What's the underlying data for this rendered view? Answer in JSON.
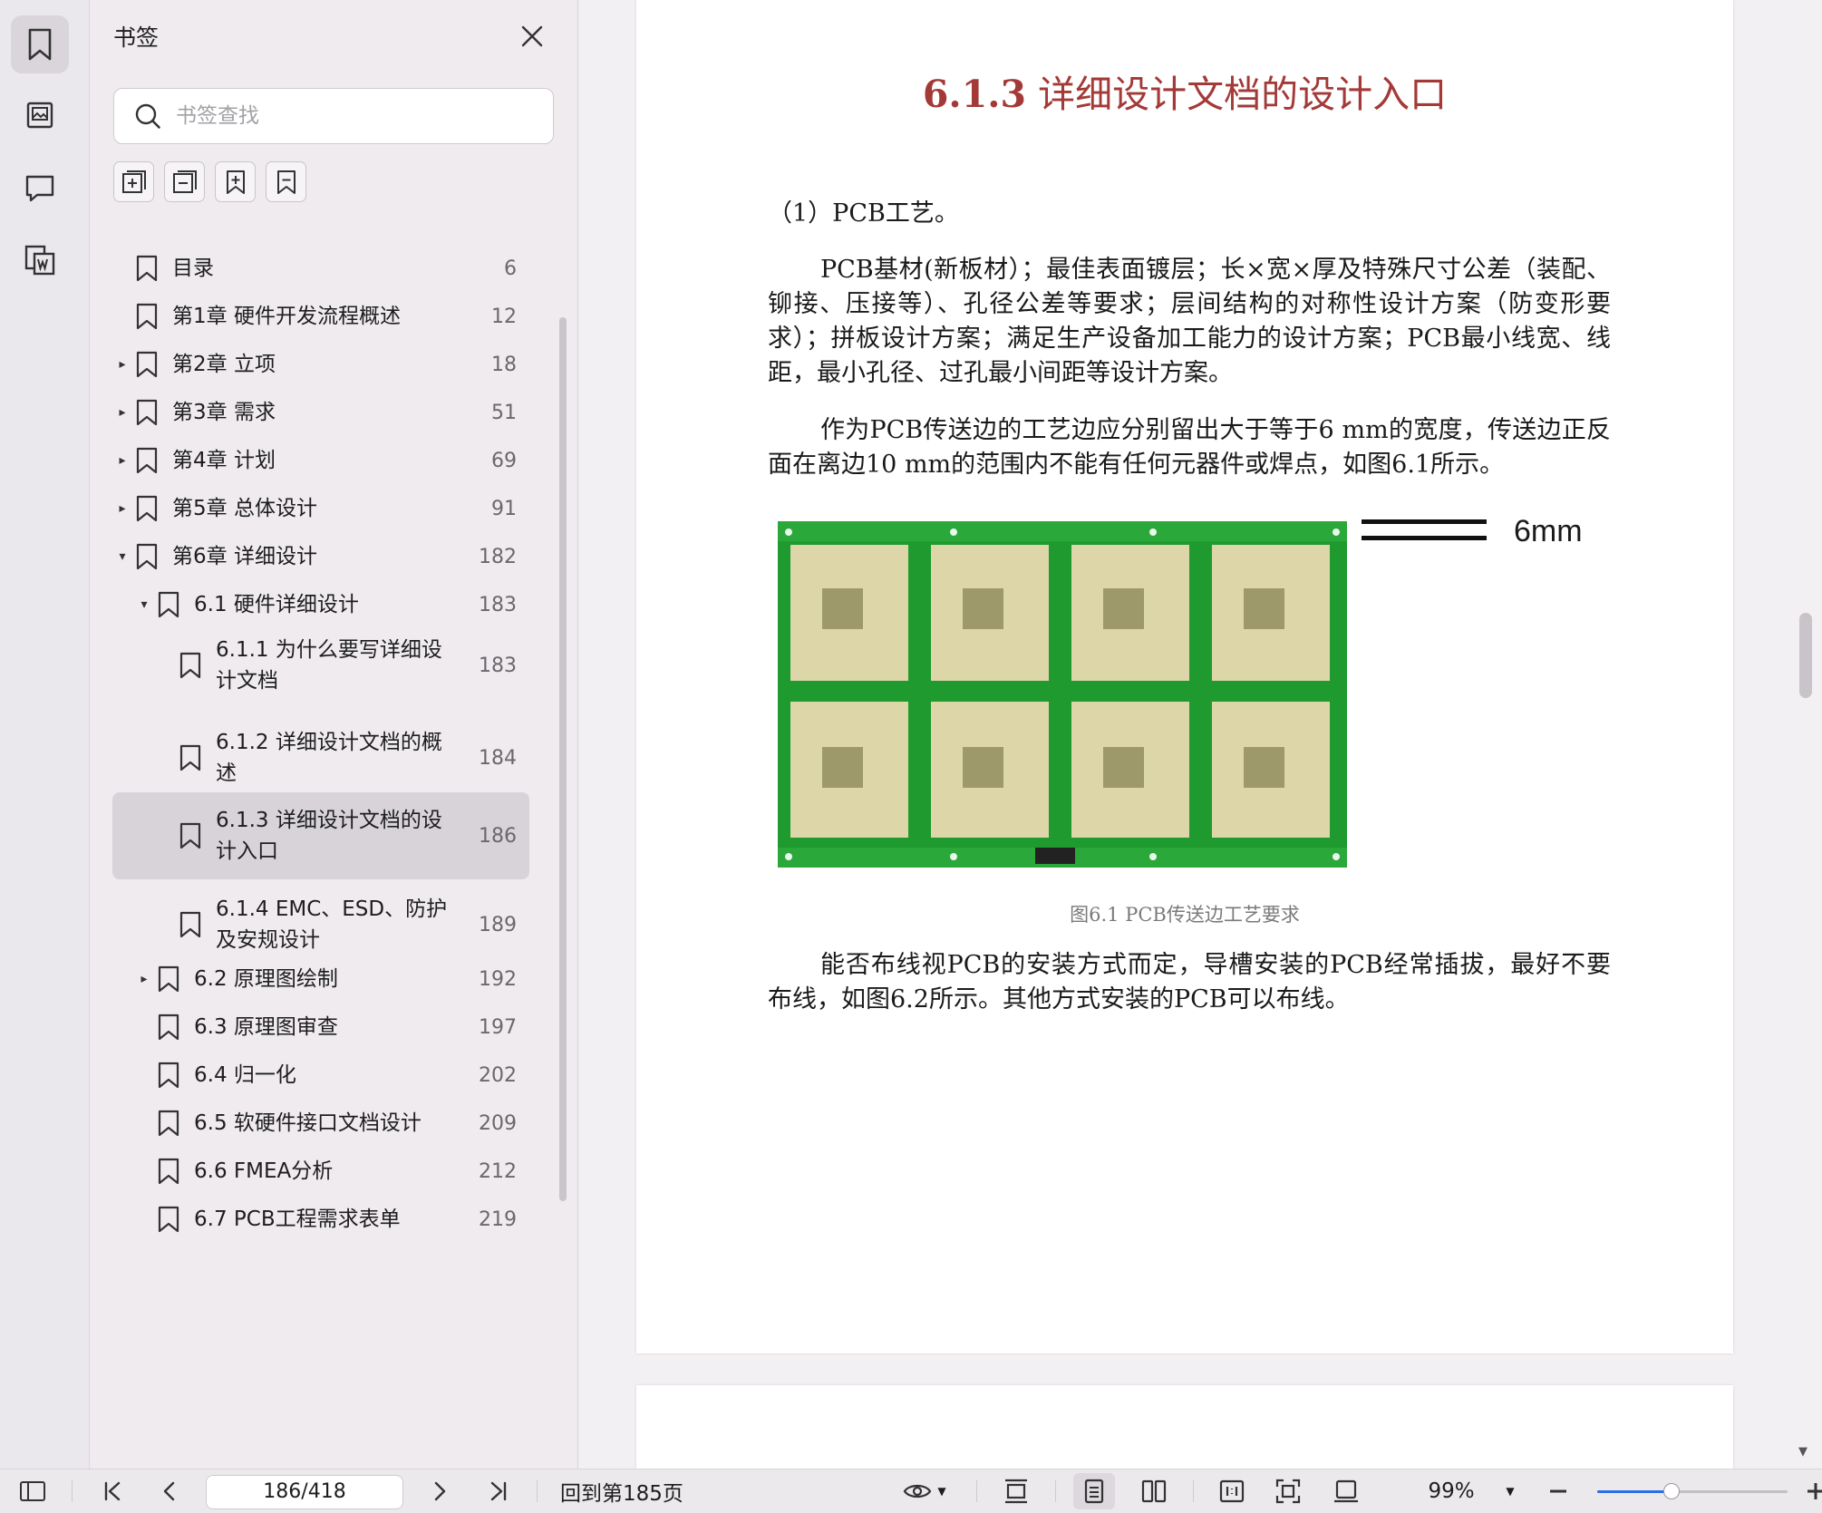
{
  "panel": {
    "title": "书签",
    "search_placeholder": "书签查找"
  },
  "bookmarks": [
    {
      "label": "目录",
      "page": "6",
      "level": 0,
      "arrow": ""
    },
    {
      "label": "第1章 硬件开发流程概述",
      "page": "12",
      "level": 0,
      "arrow": ""
    },
    {
      "label": "第2章 立项",
      "page": "18",
      "level": 0,
      "arrow": "▸"
    },
    {
      "label": "第3章 需求",
      "page": "51",
      "level": 0,
      "arrow": "▸"
    },
    {
      "label": "第4章 计划",
      "page": "69",
      "level": 0,
      "arrow": "▸"
    },
    {
      "label": "第5章 总体设计",
      "page": "91",
      "level": 0,
      "arrow": "▸"
    },
    {
      "label": "第6章 详细设计",
      "page": "182",
      "level": 0,
      "arrow": "▾"
    },
    {
      "label": "6.1 硬件详细设计",
      "page": "183",
      "level": 1,
      "arrow": "▾"
    },
    {
      "label": "6.1.1 为什么要写详细设计文档",
      "page": "183",
      "level": 2,
      "arrow": ""
    },
    {
      "label": "6.1.2 详细设计文档的概述",
      "page": "184",
      "level": 2,
      "arrow": ""
    },
    {
      "label": "6.1.3 详细设计文档的设计入口",
      "page": "186",
      "level": 2,
      "arrow": "",
      "selected": true
    },
    {
      "label": "6.1.4 EMC、ESD、防护及安规设计",
      "page": "189",
      "level": 2,
      "arrow": ""
    },
    {
      "label": "6.2 原理图绘制",
      "page": "192",
      "level": 1,
      "arrow": "▸"
    },
    {
      "label": "6.3 原理图审查",
      "page": "197",
      "level": 1,
      "arrow": ""
    },
    {
      "label": "6.4 归一化",
      "page": "202",
      "level": 1,
      "arrow": ""
    },
    {
      "label": "6.5 软硬件接口文档设计",
      "page": "209",
      "level": 1,
      "arrow": ""
    },
    {
      "label": "6.6 FMEA分析",
      "page": "212",
      "level": 1,
      "arrow": ""
    },
    {
      "label": "6.7 PCB工程需求表单",
      "page": "219",
      "level": 1,
      "arrow": ""
    }
  ],
  "document": {
    "heading_num": "6.1.3",
    "heading_text": " 详细设计文档的设计入口",
    "p1": "（1）PCB工艺。",
    "p2": "PCB基材(新板材）；最佳表面镀层；长×宽×厚及特殊尺寸公差（装配、铆接、压接等）、孔径公差等要求；层间结构的对称性设计方案（防变形要求）；拼板设计方案；满足生产设备加工能力的设计方案；PCB最小线宽、线距，最小孔径、过孔最小间距等设计方案。",
    "p3": "作为PCB传送边的工艺边应分别留出大于等于6 mm的宽度，传送边正反面在离边10 mm的范围内不能有任何元器件或焊点，如图6.1所示。",
    "figure_label": "6mm",
    "caption": "图6.1 PCB传送边工艺要求",
    "p4": "能否布线视PCB的安装方式而定，导槽安装的PCB经常插拔，最好不要布线，如图6.2所示。其他方式安装的PCB可以布线。"
  },
  "status": {
    "page_value": "186/418",
    "back_label": "回到第185页",
    "zoom": "99%",
    "zoom_fraction": 0.39
  },
  "colors": {
    "heading": "#a33a37",
    "accent": "#2d6ee6",
    "pcb_green": "#1f9a2f"
  }
}
